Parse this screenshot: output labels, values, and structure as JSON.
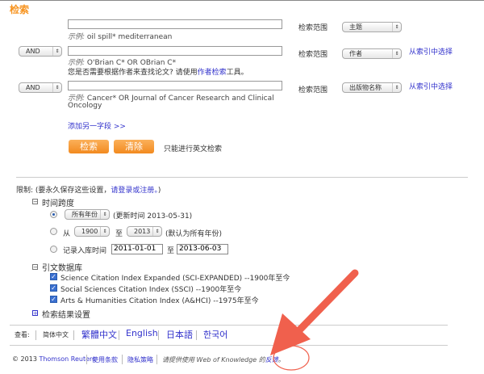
{
  "title": "检索",
  "scope_label": "检索范围",
  "rows": [
    {
      "operator": "",
      "value": "",
      "example_prefix": "示例:",
      "example": " oil spill* mediterranean",
      "field": "主题"
    },
    {
      "operator": "AND",
      "value": "",
      "example_prefix": "示例:",
      "example": " O'Brian C* OR OBrian C*",
      "field": "作者",
      "index_link": "从索引中选择",
      "hint_pre": "您是否需要根据作者来查找论文? 请使用",
      "hint_link": "作者检索",
      "hint_post": "工具。"
    },
    {
      "operator": "AND",
      "value": "",
      "example_prefix": "示例:",
      "example": " Cancer* OR Journal of Cancer Research and Clinical",
      "example2": "Oncology",
      "field": "出版物名称",
      "index_link": "从索引中选择"
    }
  ],
  "add_field": "添加另一字段 >>",
  "search_button": "检索",
  "clear_button": "清除",
  "english_only": "只能进行英文检索",
  "limits": {
    "label": "限制: (要永久保存这些设置，",
    "login_link": "请登录或注册。",
    "close": ")",
    "timespan": {
      "label": "时间跨度",
      "all_years": "所有年份",
      "updated": "(更新时间 2013-05-31)",
      "from": "从",
      "from_year": "1900",
      "to": "至",
      "to_year": "2013",
      "default_note": "(默认为所有年份)",
      "entry_label": "记录入库时间",
      "entry_from": "2011-01-01",
      "entry_to": "2013-06-03",
      "selected": "all_years"
    },
    "databases": {
      "label": "引文数据库",
      "items": [
        {
          "label": "Science Citation Index Expanded (SCI-EXPANDED) --1900年至今",
          "checked": true
        },
        {
          "label": "Social Sciences Citation Index (SSCI) --1900年至今",
          "checked": true
        },
        {
          "label": "Arts & Humanities Citation Index (A&HCI) --1975年至今",
          "checked": true
        }
      ]
    },
    "results_settings": "检索结果设置"
  },
  "languages": {
    "label": "查看:",
    "items": [
      "简体中文",
      "繁體中文",
      "English",
      "日本語",
      "한국어"
    ]
  },
  "footer": {
    "copyright": "© 2013 ",
    "company": "Thomson Reuters",
    "terms": "使用条款",
    "privacy": "隐私策略",
    "feedback_pre": "请提供使用 Web of Knowledge 的",
    "feedback_link": "反馈",
    "feedback_post": "。"
  },
  "colors": {
    "accent": "#f7931e",
    "link": "#3333cc",
    "annotation": "#f0604d"
  }
}
